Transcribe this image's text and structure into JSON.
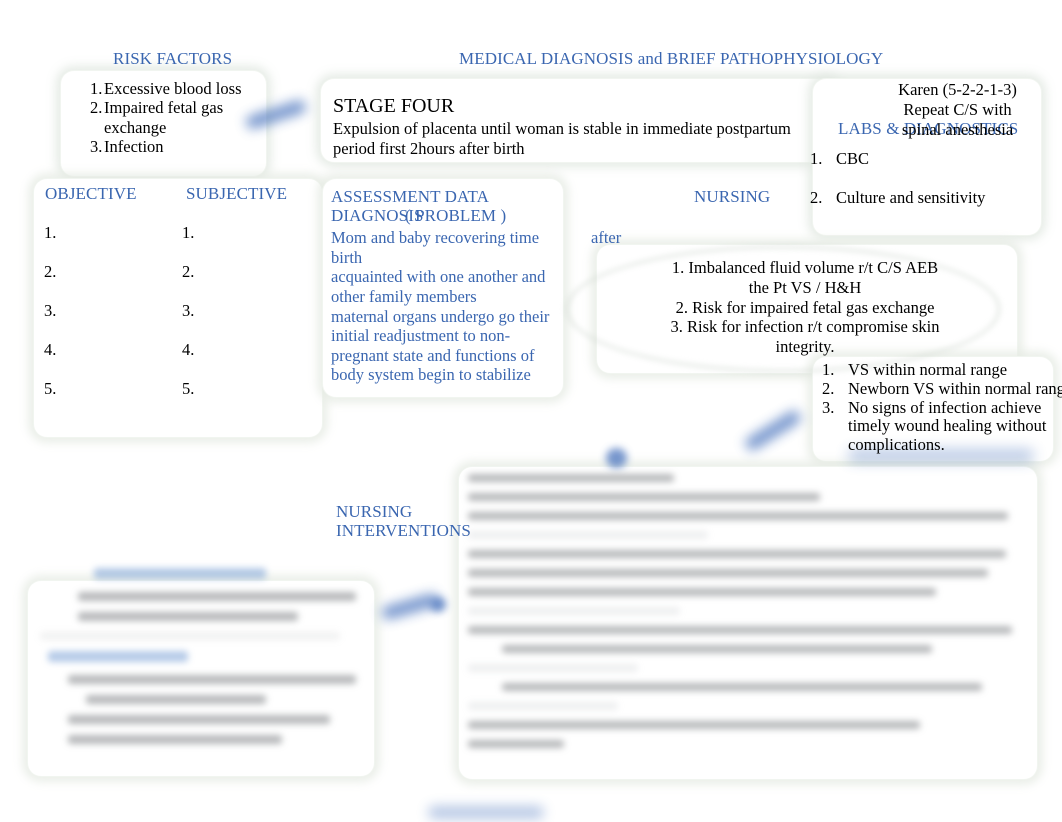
{
  "document": {
    "type": "nursing-care-plan-slide",
    "accent_color": "#3A66B0",
    "text_color": "#000000",
    "background": "#FFFFFF"
  },
  "headers": {
    "risk_factors": "RISK FACTORS",
    "medical_diagnosis": "MEDICAL DIAGNOSIS and BRIEF PATHOPHYSIOLOGY",
    "labs_diagnostics": "LABS & DIAGNOSTICS",
    "objective": "OBJECTIVE",
    "subjective": "SUBJECTIVE",
    "assessment_data": "ASSESSMENT DATA",
    "diagnosis_problem_1": "DIAGNOSIS",
    "diagnosis_problem_2": "( PROBLEM )",
    "nursing": "NURSING",
    "nursing_interventions_1": "NURSING",
    "nursing_interventions_2": "INTERVENTIONS"
  },
  "risk_factors": {
    "items": [
      {
        "num": "1.",
        "text": "Excessive blood loss"
      },
      {
        "num": "2.",
        "text": "Impaired fetal gas exchange"
      },
      {
        "num": "3.",
        "text": "Infection"
      }
    ]
  },
  "medical_diagnosis": {
    "stage_title": "STAGE FOUR",
    "body": "Expulsion of placenta until woman is stable in immediate postpartum period first 2hours after birth"
  },
  "patient": {
    "name_line": "Karen (5-2-2-1-3)",
    "procedure_line_1": "Repeat C/S with",
    "procedure_line_2": "spinal anesthesia"
  },
  "labs": {
    "items": [
      {
        "num": "1.",
        "text": "CBC"
      },
      {
        "num": "2.",
        "text": "Culture and sensitivity"
      }
    ]
  },
  "objective": {
    "items": [
      "1.",
      "2.",
      "3.",
      "4.",
      "5."
    ]
  },
  "subjective": {
    "items": [
      "1.",
      "2.",
      "3.",
      "4.",
      "5."
    ]
  },
  "assessment": {
    "lines": [
      "Mom and baby recovering time",
      "birth",
      "acquainted with one another and",
      "other family members",
      "maternal organs undergo go their",
      "initial readjustment to non-",
      "pregnant state and functions of",
      "body system begin to stabilize"
    ],
    "floating_word": "after"
  },
  "nursing_diagnosis": {
    "items": [
      {
        "num": "1.",
        "line1": "Imbalanced fluid volume r/t C/S AEB",
        "line2": "the Pt VS / H&H"
      },
      {
        "num": "2.",
        "line1": "Risk for impaired fetal gas exchange",
        "line2": ""
      },
      {
        "num": "3.",
        "line1": "Risk for infection r/t compromise skin",
        "line2": "integrity."
      }
    ]
  },
  "expected_outcomes": {
    "items": [
      {
        "num": "1.",
        "text": "VS within normal range"
      },
      {
        "num": "2.",
        "text": "Newborn VS within normal range"
      },
      {
        "num": "3.",
        "text": "No signs of infection achieve timely wound healing without complications."
      }
    ]
  },
  "obscured": {
    "note": "blurred-illegible-content",
    "bottom_left_panel": "blurred",
    "bottom_right_panel": "blurred",
    "bottom_caption": "blurred"
  }
}
